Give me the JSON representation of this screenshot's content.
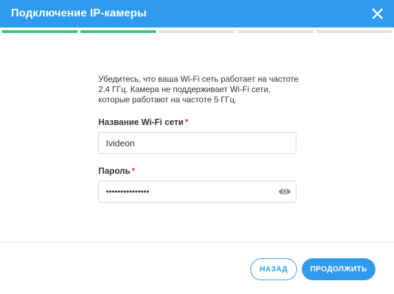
{
  "dialog": {
    "title": "Подключение IP-камеры",
    "close_icon": "close-icon"
  },
  "progress": {
    "total_steps": 5,
    "completed_steps": 2,
    "done_color": "#35c27f",
    "pending_color": "#e2e2e2"
  },
  "info_text": "Убедитесь, что ваша Wi-Fi сеть работает на частоте 2,4 ГГц. Камера не поддерживает Wi-Fi сети, которые работают на частоте 5 ГГц.",
  "wifi": {
    "label": "Название Wi-Fi сети",
    "required_mark": "*",
    "value": "Ivideon"
  },
  "password": {
    "label": "Пароль",
    "required_mark": "*",
    "value": "•••••••••••••••",
    "toggle_icon": "eye-icon"
  },
  "actions": {
    "back_label": "НАЗАД",
    "next_label": "ПРОДОЛЖИТЬ"
  },
  "colors": {
    "accent": "#2f9bee",
    "required": "#e0413b"
  }
}
